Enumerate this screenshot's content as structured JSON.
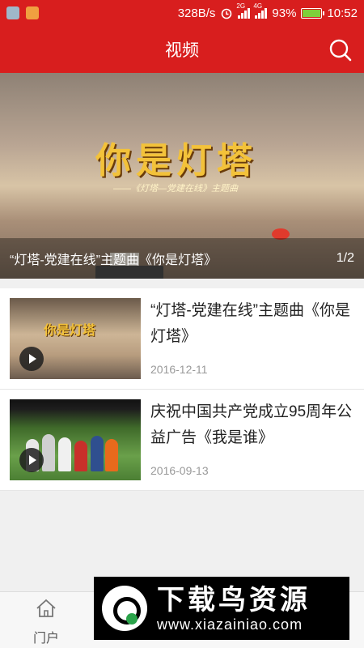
{
  "status_bar": {
    "speed": "328B/s",
    "network1": "2G",
    "network2": "4G",
    "battery": "93%",
    "battery_level": 0.93,
    "time": "10:52",
    "icons": [
      "app-notification-icon",
      "app-notification-icon",
      "alarm-icon",
      "signal-icon",
      "battery-icon"
    ]
  },
  "app_bar": {
    "title": "视频",
    "search_icon": "search-icon"
  },
  "banner": {
    "art_title": "你是灯塔",
    "art_subtitle": "——《灯塔—党建在线》主题曲",
    "caption": "“灯塔-党建在线”主题曲《你是灯塔》",
    "counter": "1/2"
  },
  "videos": [
    {
      "title": "“灯塔-党建在线”主题曲《你是灯塔》",
      "thumb_text": "你是灯塔",
      "date": "2016-12-11"
    },
    {
      "title": "庆祝中国共产党成立95周年公益广告《我是谁》",
      "date": "2016-09-13"
    }
  ],
  "tab_bar": {
    "home_label": "门户",
    "home_icon": "home-icon"
  },
  "watermark": {
    "name": "下载鸟资源",
    "url": "www.xiazainiao.com"
  },
  "colors": {
    "primary": "#d81e1e",
    "date_text": "#999999"
  }
}
